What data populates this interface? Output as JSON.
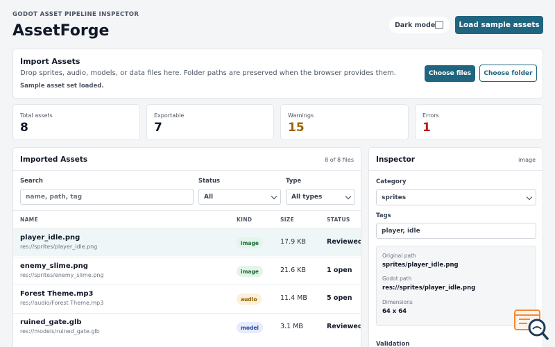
{
  "header": {
    "eyebrow": "GODOT ASSET PIPELINE INSPECTOR",
    "title": "AssetForge",
    "dark_mode_label": "Dark mode",
    "load_button": "Load sample assets"
  },
  "import": {
    "title": "Import Assets",
    "description": "Drop sprites, audio, models, or data files here. Folder paths are preserved when the browser provides them.",
    "status": "Sample asset set loaded.",
    "choose_files": "Choose files",
    "choose_folder": "Choose folder"
  },
  "stats": [
    {
      "label": "Total assets",
      "value": "8",
      "color": "#111827"
    },
    {
      "label": "Exportable",
      "value": "7",
      "color": "#111827"
    },
    {
      "label": "Warnings",
      "value": "15",
      "color": "#9a6408"
    },
    {
      "label": "Errors",
      "value": "1",
      "color": "#b91c1c"
    }
  ],
  "assets": {
    "title": "Imported Assets",
    "count": "8 of 8 files",
    "filters": {
      "search_label": "Search",
      "search_placeholder": "name, path, tag",
      "status_label": "Status",
      "status_value": "All",
      "type_label": "Type",
      "type_value": "All types"
    },
    "columns": [
      "NAME",
      "KIND",
      "SIZE",
      "STATUS"
    ],
    "rows": [
      {
        "name": "player_idle.png",
        "path": "res://sprites/player_idle.png",
        "kind": "image",
        "size": "17.9 KB",
        "status": "Reviewed"
      },
      {
        "name": "enemy_slime.png",
        "path": "res://sprites/enemy_slime.png",
        "kind": "image",
        "size": "21.6 KB",
        "status": "1 open"
      },
      {
        "name": "Forest Theme.mp3",
        "path": "res://audio/Forest Theme.mp3",
        "kind": "audio",
        "size": "11.4 MB",
        "status": "5 open"
      },
      {
        "name": "ruined_gate.glb",
        "path": "res://models/ruined_gate.glb",
        "kind": "model",
        "size": "3.1 MB",
        "status": "Reviewed"
      }
    ]
  },
  "inspector": {
    "title": "Inspector",
    "kind": "image",
    "category_label": "Category",
    "category_value": "sprites",
    "tags_label": "Tags",
    "tags_value": "player, idle",
    "original_path_label": "Original path",
    "original_path": "sprites/player_idle.png",
    "godot_path_label": "Godot path",
    "godot_path": "res://sprites/player_idle.png",
    "dimensions_label": "Dimensions",
    "dimensions": "64 x 64",
    "validation_label": "Validation"
  },
  "colors": {
    "accent": "#1f6580",
    "warning": "#9a6408",
    "error": "#b91c1c"
  }
}
